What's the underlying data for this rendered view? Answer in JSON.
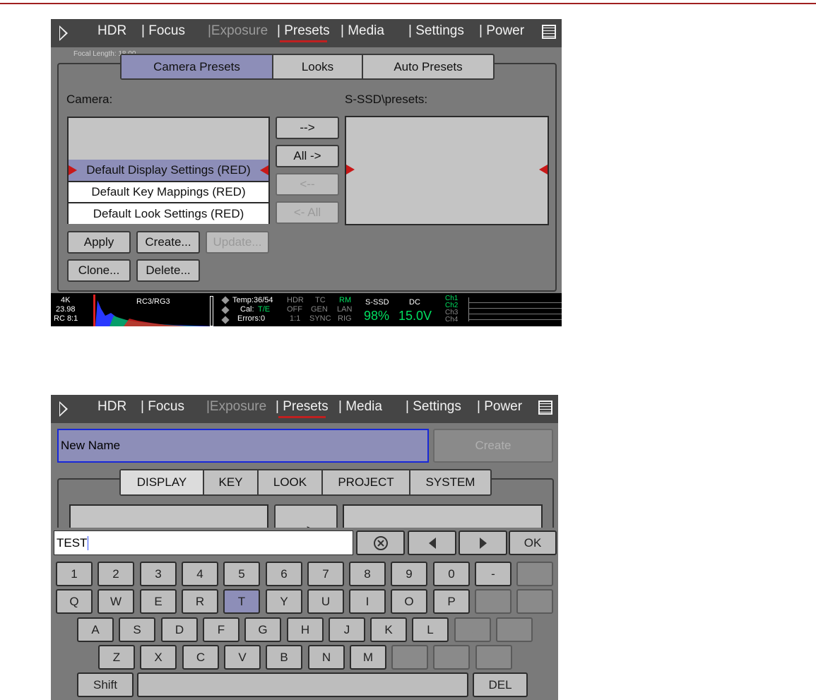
{
  "menu": {
    "items": [
      {
        "label": "HDR",
        "state": "normal"
      },
      {
        "label": "| Focus",
        "state": "normal"
      },
      {
        "label": "|Exposure",
        "state": "disabled"
      },
      {
        "label": "| Presets",
        "state": "active"
      },
      {
        "label": "| Media",
        "state": "normal"
      },
      {
        "label": "| Settings",
        "state": "normal"
      },
      {
        "label": "| Power",
        "state": "normal"
      }
    ],
    "icons": [
      "play-icon",
      "menu-list-icon"
    ]
  },
  "screen1": {
    "background_text": "Focal Length: 18.00",
    "tabs": [
      "Camera Presets",
      "Looks",
      "Auto Presets"
    ],
    "selected_tab": "Camera Presets",
    "camera_label": "Camera:",
    "target_label": "S-SSD\\presets:",
    "camera_list": [
      "Default Display Settings (RED)",
      "Default Key Mappings (RED)",
      "Default Look Settings (RED)"
    ],
    "selected_item": "Default Display Settings (RED)",
    "transfer_buttons": [
      "-->",
      "All ->",
      "<--",
      "<- All"
    ],
    "action_buttons": [
      "Apply",
      "Create...",
      "Update...",
      "Clone...",
      "Delete..."
    ]
  },
  "status": {
    "format": "4K",
    "fps": "23.98",
    "compression": "RC 8:1",
    "color": "RC3/RG3",
    "temp": "Temp:36/54",
    "cal_label": "Cal:",
    "cal_value": "T/E",
    "errors": "Errors:0",
    "hdr": "HDR",
    "hdr_val": "OFF",
    "ratio": "1:1",
    "tc": "TC",
    "gen": "GEN",
    "sync": "SYNC",
    "rm": "RM",
    "lan": "LAN",
    "rig": "RIG",
    "media": "S-SSD",
    "media_pct": "98%",
    "power": "DC",
    "voltage": "15.0V",
    "channels": [
      "Ch1",
      "Ch2",
      "Ch3",
      "Ch4"
    ],
    "colors": {
      "green": "#00e060",
      "red": "#e02020"
    }
  },
  "screen2": {
    "name_value": "New Name",
    "create_button": "Create",
    "tabs": [
      "DISPLAY",
      "KEY",
      "LOOK",
      "PROJECT",
      "SYSTEM"
    ],
    "selected_tab": "DISPLAY",
    "transfer_button": "-->",
    "keyboard": {
      "input_value": "TEST",
      "ok_label": "OK",
      "row1": [
        "1",
        "2",
        "3",
        "4",
        "5",
        "6",
        "7",
        "8",
        "9",
        "0",
        "-",
        "="
      ],
      "row2": [
        "Q",
        "W",
        "E",
        "R",
        "T",
        "Y",
        "U",
        "I",
        "O",
        "P",
        "[",
        "]"
      ],
      "row3": [
        "A",
        "S",
        "D",
        "F",
        "G",
        "H",
        "J",
        "K",
        "L",
        ";",
        "'"
      ],
      "row4": [
        "Z",
        "X",
        "C",
        "V",
        "B",
        "N",
        "M",
        ",",
        ".",
        "/"
      ],
      "shift_label": "Shift",
      "del_label": "DEL",
      "highlighted_key": "T",
      "accent": "#8d8eb8"
    }
  }
}
